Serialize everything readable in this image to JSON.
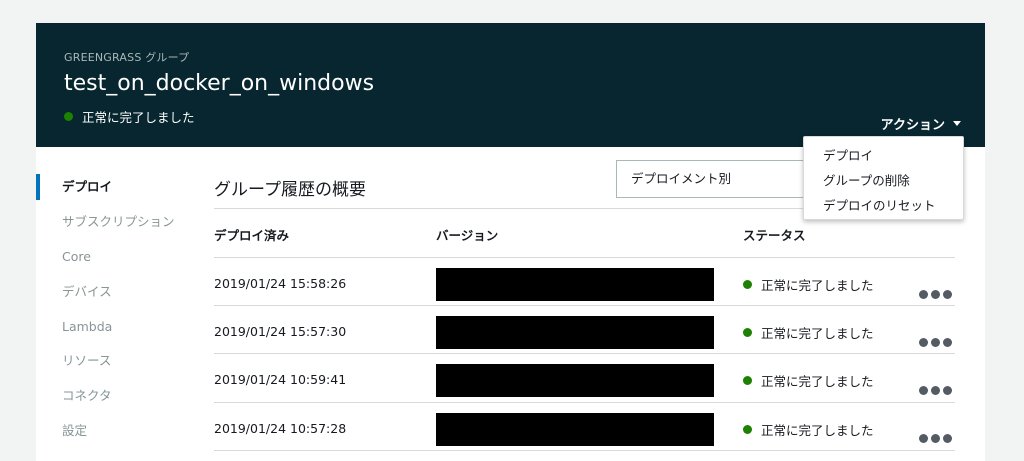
{
  "header": {
    "eyebrow": "GREENGRASS グループ",
    "title": "test_on_docker_on_windows",
    "status": "正常に完了しました",
    "actions_label": "アクション"
  },
  "actions_menu": {
    "items": [
      "デプロイ",
      "グループの削除",
      "デプロイのリセット"
    ]
  },
  "sidebar": {
    "items": [
      {
        "label": "デプロイ",
        "active": true
      },
      {
        "label": "サブスクリプション"
      },
      {
        "label": "Core"
      },
      {
        "label": "デバイス"
      },
      {
        "label": "Lambda"
      },
      {
        "label": "リソース"
      },
      {
        "label": "コネクタ"
      },
      {
        "label": "設定"
      }
    ]
  },
  "main": {
    "title": "グループ履歴の概要",
    "filter_select": "デプロイメント別"
  },
  "table": {
    "columns": [
      "デプロイ済み",
      "バージョン",
      "ステータス"
    ],
    "rows": [
      {
        "deployed": "2019/01/24 15:58:26",
        "status": "正常に完了しました"
      },
      {
        "deployed": "2019/01/24 15:57:30",
        "status": "正常に完了しました"
      },
      {
        "deployed": "2019/01/24 10:59:41",
        "status": "正常に完了しました"
      },
      {
        "deployed": "2019/01/24 10:57:28",
        "status": "正常に完了しました"
      }
    ]
  },
  "colors": {
    "header_bg": "#07262f",
    "status_success": "#1d8102",
    "active_indicator": "#0073bb"
  }
}
